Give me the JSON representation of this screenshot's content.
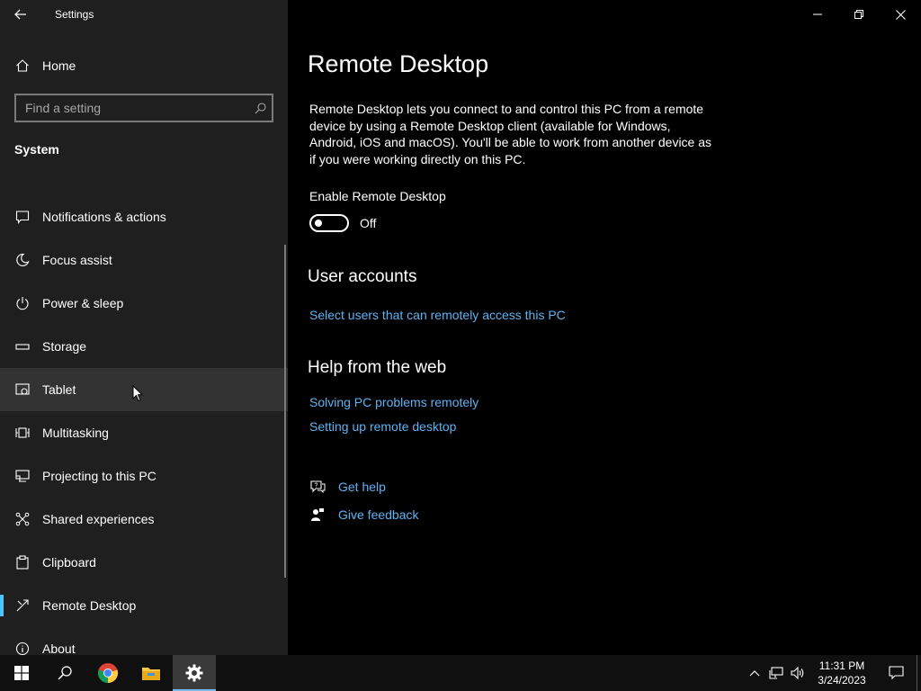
{
  "app": {
    "title": "Settings"
  },
  "sidebar": {
    "home_label": "Home",
    "search_placeholder": "Find a setting",
    "section_title": "System",
    "items": [
      {
        "label": "Notifications & actions",
        "icon": "notification-icon"
      },
      {
        "label": "Focus assist",
        "icon": "moon-icon"
      },
      {
        "label": "Power & sleep",
        "icon": "power-icon"
      },
      {
        "label": "Storage",
        "icon": "storage-icon"
      },
      {
        "label": "Tablet",
        "icon": "tablet-icon"
      },
      {
        "label": "Multitasking",
        "icon": "multitasking-icon"
      },
      {
        "label": "Projecting to this PC",
        "icon": "projecting-icon"
      },
      {
        "label": "Shared experiences",
        "icon": "shared-experiences-icon"
      },
      {
        "label": "Clipboard",
        "icon": "clipboard-icon"
      },
      {
        "label": "Remote Desktop",
        "icon": "remote-desktop-icon"
      },
      {
        "label": "About",
        "icon": "info-icon"
      }
    ],
    "hovered_item": "Tablet",
    "selected_item": "Remote Desktop"
  },
  "main": {
    "title": "Remote Desktop",
    "description": "Remote Desktop lets you connect to and control this PC from a remote device by using a Remote Desktop client (available for Windows, Android, iOS and macOS). You'll be able to work from another device as if you were working directly on this PC.",
    "toggle": {
      "label": "Enable Remote Desktop",
      "state": "Off"
    },
    "user_accounts": {
      "heading": "User accounts",
      "link": "Select users that can remotely access this PC"
    },
    "help_web": {
      "heading": "Help from the web",
      "links": [
        "Solving PC problems remotely",
        "Setting up remote desktop"
      ]
    },
    "get_help": "Get help",
    "give_feedback": "Give feedback"
  },
  "taskbar": {
    "time": "11:31 PM",
    "date": "3/24/2023"
  },
  "colors": {
    "accent": "#4cc2ff",
    "link": "#5fb2f2",
    "sidebar_bg": "#1f1f1f",
    "main_bg": "#000000"
  }
}
